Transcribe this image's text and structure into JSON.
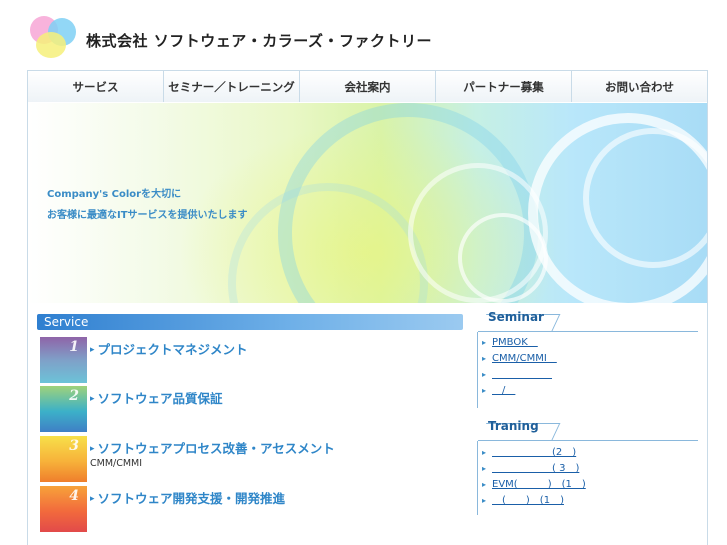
{
  "header": {
    "company_name": "株式会社 ソフトウェア・カラーズ・ファクトリー"
  },
  "nav": [
    {
      "label": "サービス"
    },
    {
      "label": "セミナー／トレーニング"
    },
    {
      "label": "会社案内"
    },
    {
      "label": "パートナー募集"
    },
    {
      "label": "お問い合わせ"
    }
  ],
  "hero": {
    "line1": "Company's Colorを大切に",
    "line2": "お客様に最適なITサービスを提供いたします"
  },
  "services": {
    "heading": "Service",
    "items": [
      {
        "num": "1",
        "title": "プロジェクトマネジメント",
        "sub": ""
      },
      {
        "num": "2",
        "title": "ソフトウェア品質保証",
        "sub": ""
      },
      {
        "num": "3",
        "title": "ソフトウェアプロセス改善・アセスメント",
        "sub": "CMM/CMMI"
      },
      {
        "num": "4",
        "title": "ソフトウェア開発支援・開発推進",
        "sub": ""
      }
    ]
  },
  "seminar": {
    "heading": "Seminar",
    "items": [
      {
        "text": "PMBOK　"
      },
      {
        "text": "CMM/CMMI　"
      },
      {
        "text": "　　　　　　"
      },
      {
        "text": "　/　"
      }
    ]
  },
  "training": {
    "heading": "Traning",
    "items": [
      {
        "text": "　　　　　　(2　)"
      },
      {
        "text": "　　　　　　( 3　)"
      },
      {
        "text": "EVM(　　　)　(1　)"
      },
      {
        "text": "　(　　)　(1　)"
      }
    ]
  },
  "colors": {
    "accent": "#2f86c8",
    "nav_border": "#c9dbe8",
    "heading_blue": "#1f5f9a"
  }
}
